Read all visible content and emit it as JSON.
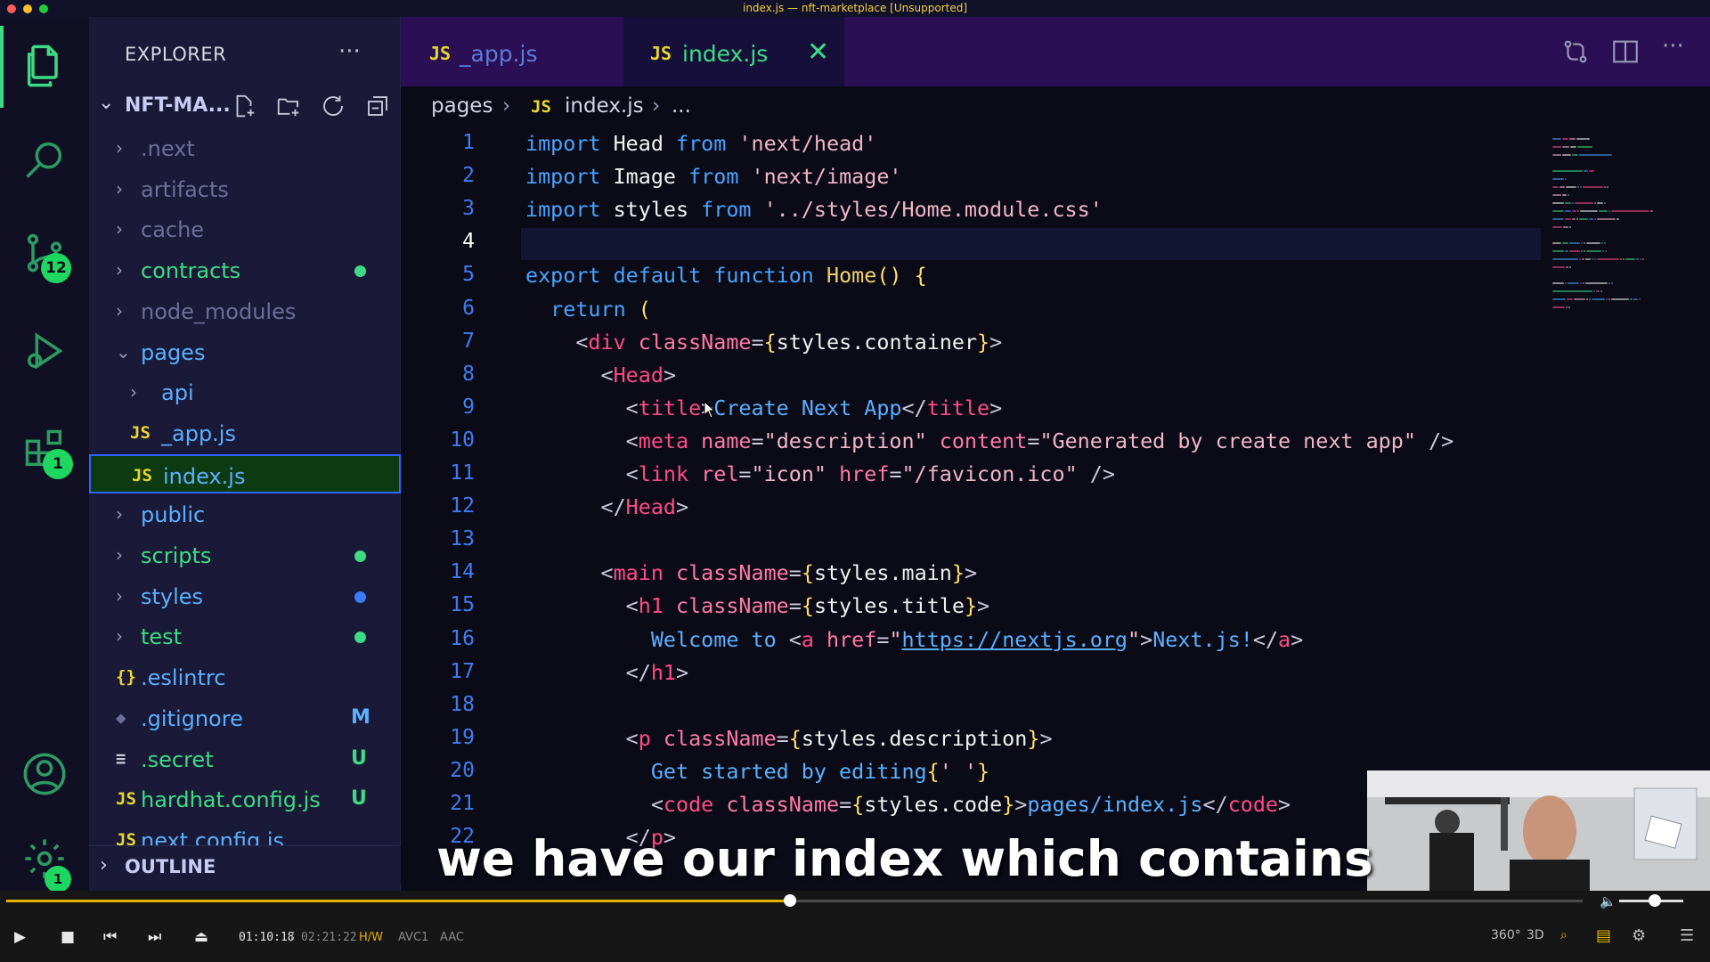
{
  "window": {
    "title": "index.js — nft-marketplace [Unsupported]"
  },
  "activity_bar": {
    "source_control_badge": "12",
    "extensions_badge": "1",
    "settings_badge": "1"
  },
  "sidebar": {
    "title": "EXPLORER",
    "more": "···",
    "project": "NFT-MA...",
    "tree": [
      {
        "label": ".next",
        "kind": "folder",
        "color": "#6d6d98"
      },
      {
        "label": "artifacts",
        "kind": "folder",
        "color": "#6d6d98"
      },
      {
        "label": "cache",
        "kind": "folder",
        "color": "#6d6d98"
      },
      {
        "label": "contracts",
        "kind": "folder",
        "color": "#3ddc84",
        "dot": "#3ddc84"
      },
      {
        "label": "node_modules",
        "kind": "folder",
        "color": "#6d6d98"
      },
      {
        "label": "pages",
        "kind": "folder-open",
        "color": "#5ab0ff"
      },
      {
        "label": "api",
        "kind": "folder",
        "color": "#5ab0ff"
      },
      {
        "label": "_app.js",
        "kind": "js",
        "color": "#5ab0ff",
        "icon": "JS"
      },
      {
        "label": "index.js",
        "kind": "js",
        "color": "#5ab0ff",
        "icon": "JS",
        "selected": true
      },
      {
        "label": "public",
        "kind": "folder",
        "color": "#5ab0ff"
      },
      {
        "label": "scripts",
        "kind": "folder",
        "color": "#3ddc84",
        "dot": "#3ddc84"
      },
      {
        "label": "styles",
        "kind": "folder",
        "color": "#5ab0ff",
        "dot": "#3a7bff"
      },
      {
        "label": "test",
        "kind": "folder",
        "color": "#3ddc84",
        "dot": "#3ddc84"
      },
      {
        "label": ".eslintrc",
        "kind": "json",
        "color": "#5ab0ff",
        "icon": "{}"
      },
      {
        "label": ".gitignore",
        "kind": "git",
        "color": "#5ab0ff",
        "icon": "◆",
        "flag": "M",
        "flag_color": "#5ab0ff"
      },
      {
        "label": ".secret",
        "kind": "text",
        "color": "#3ddc84",
        "icon": "≡",
        "flag": "U",
        "flag_color": "#3ddc84"
      },
      {
        "label": "hardhat.config.js",
        "kind": "js",
        "color": "#3ddc84",
        "icon": "JS",
        "flag": "U",
        "flag_color": "#3ddc84"
      },
      {
        "label": "next.config.js",
        "kind": "js",
        "color": "#5ab0ff",
        "icon": "JS"
      }
    ],
    "outline": "OUTLINE"
  },
  "tabs": [
    {
      "icon": "JS",
      "label": "_app.js",
      "active": false
    },
    {
      "icon": "JS",
      "label": "index.js",
      "active": true,
      "close": "✕"
    }
  ],
  "breadcrumb": {
    "folder": "pages",
    "sep1": "›",
    "icon": "JS",
    "file": "index.js",
    "sep2": "›",
    "more": "..."
  },
  "editor": {
    "current_line": 4,
    "lines": [
      [
        [
          "kw",
          "import "
        ],
        [
          "ident",
          "Head "
        ],
        [
          "kw",
          "from "
        ],
        [
          "str",
          "'next/head'"
        ]
      ],
      [
        [
          "kw",
          "import "
        ],
        [
          "ident",
          "Image "
        ],
        [
          "kw",
          "from "
        ],
        [
          "str",
          "'next/image'"
        ]
      ],
      [
        [
          "kw",
          "import "
        ],
        [
          "ident",
          "styles "
        ],
        [
          "kw",
          "from "
        ],
        [
          "str",
          "'../styles/Home.module.css'"
        ]
      ],
      [],
      [
        [
          "kw",
          "export default function "
        ],
        [
          "func",
          "Home"
        ],
        [
          "br",
          "() {"
        ]
      ],
      [
        [
          "kw",
          "  return "
        ],
        [
          "br",
          "("
        ]
      ],
      [
        [
          "punct",
          "    <"
        ],
        [
          "tag",
          "div "
        ],
        [
          "attr",
          "className"
        ],
        [
          "punct",
          "="
        ],
        [
          "br",
          "{"
        ],
        [
          "expr",
          "styles.container"
        ],
        [
          "br",
          "}"
        ],
        [
          "punct",
          ">"
        ]
      ],
      [
        [
          "punct",
          "      <"
        ],
        [
          "tag",
          "Head"
        ],
        [
          "punct",
          ">"
        ]
      ],
      [
        [
          "punct",
          "        <"
        ],
        [
          "tag",
          "title"
        ],
        [
          "punct",
          ">"
        ],
        [
          "text",
          "Create Next App"
        ],
        [
          "punct",
          "</"
        ],
        [
          "tag",
          "title"
        ],
        [
          "punct",
          ">"
        ]
      ],
      [
        [
          "punct",
          "        <"
        ],
        [
          "tag",
          "meta "
        ],
        [
          "attr",
          "name"
        ],
        [
          "punct",
          "="
        ],
        [
          "str",
          "\"description\" "
        ],
        [
          "attr",
          "content"
        ],
        [
          "punct",
          "="
        ],
        [
          "str",
          "\"Generated by create next app\" "
        ],
        [
          "punct",
          "/>"
        ]
      ],
      [
        [
          "punct",
          "        <"
        ],
        [
          "tag",
          "link "
        ],
        [
          "attr",
          "rel"
        ],
        [
          "punct",
          "="
        ],
        [
          "str",
          "\"icon\" "
        ],
        [
          "attr",
          "href"
        ],
        [
          "punct",
          "="
        ],
        [
          "str",
          "\"/favicon.ico\" "
        ],
        [
          "punct",
          "/>"
        ]
      ],
      [
        [
          "punct",
          "      </"
        ],
        [
          "tag",
          "Head"
        ],
        [
          "punct",
          ">"
        ]
      ],
      [],
      [
        [
          "punct",
          "      <"
        ],
        [
          "tag",
          "main "
        ],
        [
          "attr",
          "className"
        ],
        [
          "punct",
          "="
        ],
        [
          "br",
          "{"
        ],
        [
          "expr",
          "styles.main"
        ],
        [
          "br",
          "}"
        ],
        [
          "punct",
          ">"
        ]
      ],
      [
        [
          "punct",
          "        <"
        ],
        [
          "tag",
          "h1 "
        ],
        [
          "attr",
          "className"
        ],
        [
          "punct",
          "="
        ],
        [
          "br",
          "{"
        ],
        [
          "expr",
          "styles.title"
        ],
        [
          "br",
          "}"
        ],
        [
          "punct",
          ">"
        ]
      ],
      [
        [
          "text",
          "          Welcome to "
        ],
        [
          "punct",
          "<"
        ],
        [
          "tag",
          "a "
        ],
        [
          "attr",
          "href"
        ],
        [
          "punct",
          "="
        ],
        [
          "str",
          "\""
        ],
        [
          "link",
          "https://nextjs.org"
        ],
        [
          "str",
          "\""
        ],
        [
          "punct",
          ">"
        ],
        [
          "text",
          "Next.js!"
        ],
        [
          "punct",
          "</"
        ],
        [
          "tag",
          "a"
        ],
        [
          "punct",
          ">"
        ]
      ],
      [
        [
          "punct",
          "        </"
        ],
        [
          "tag",
          "h1"
        ],
        [
          "punct",
          ">"
        ]
      ],
      [],
      [
        [
          "punct",
          "        <"
        ],
        [
          "tag",
          "p "
        ],
        [
          "attr",
          "className"
        ],
        [
          "punct",
          "="
        ],
        [
          "br",
          "{"
        ],
        [
          "expr",
          "styles.description"
        ],
        [
          "br",
          "}"
        ],
        [
          "punct",
          ">"
        ]
      ],
      [
        [
          "text",
          "          Get started by editing"
        ],
        [
          "br",
          "{"
        ],
        [
          "str",
          "' '"
        ],
        [
          "br",
          "}"
        ]
      ],
      [
        [
          "punct",
          "          <"
        ],
        [
          "tag",
          "code "
        ],
        [
          "attr",
          "className"
        ],
        [
          "punct",
          "="
        ],
        [
          "br",
          "{"
        ],
        [
          "expr",
          "styles.code"
        ],
        [
          "br",
          "}"
        ],
        [
          "punct",
          ">"
        ],
        [
          "text",
          "pages/index.js"
        ],
        [
          "punct",
          "</"
        ],
        [
          "tag",
          "code"
        ],
        [
          "punct",
          ">"
        ]
      ],
      [
        [
          "punct",
          "        </"
        ],
        [
          "tag",
          "p"
        ],
        [
          "punct",
          ">"
        ]
      ]
    ]
  },
  "caption": "we have our index which contains",
  "player": {
    "time_current": "01:10:18",
    "time_separator": "/",
    "time_total": "02:21:22",
    "progress": 0.497,
    "volume": 0.55,
    "hw": "H/W",
    "video_codec": "AVC1",
    "audio_codec": "AAC",
    "mode_360": "360°",
    "mode_3d": "3D",
    "colors": {
      "accent": "#e6b400"
    }
  },
  "colors": {
    "accent_green": "#3ddc84",
    "tab_bar": "#2a0f55",
    "sidebar": "#1a1937",
    "editor": "#0b0b18"
  }
}
